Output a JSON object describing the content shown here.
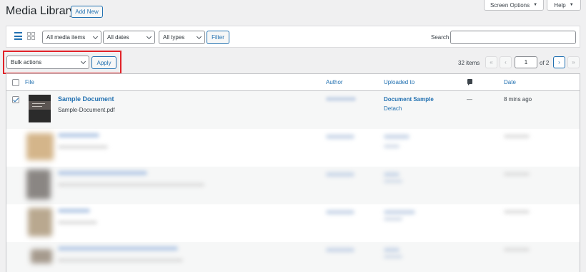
{
  "header": {
    "title": "Media Library",
    "add_new_label": "Add New",
    "screen_options_label": "Screen Options",
    "help_label": "Help"
  },
  "filters": {
    "media_type_selected": "All media items",
    "date_selected": "All dates",
    "type_selected": "All types",
    "filter_label": "Filter",
    "search_label": "Search",
    "search_value": ""
  },
  "bulk": {
    "selected": "Bulk actions",
    "apply_label": "Apply"
  },
  "pagination": {
    "items_text": "32 items",
    "first": "«",
    "prev": "‹",
    "current_page": "1",
    "of_text": "of 2",
    "next": "›",
    "last": "»"
  },
  "table": {
    "columns": {
      "file": "File",
      "author": "Author",
      "uploaded_to": "Uploaded to",
      "comments_icon": "comment-icon",
      "date": "Date"
    },
    "rows": [
      {
        "title": "Sample Document",
        "filename": "Sample-Document.pdf",
        "uploaded_to": "Document Sample",
        "detach_label": "Detach",
        "comments": "—",
        "date": "8 mins ago",
        "checked": true
      }
    ]
  },
  "colors": {
    "accent": "#2271b1",
    "highlight": "#e12228",
    "background": "#f0f0f1"
  }
}
